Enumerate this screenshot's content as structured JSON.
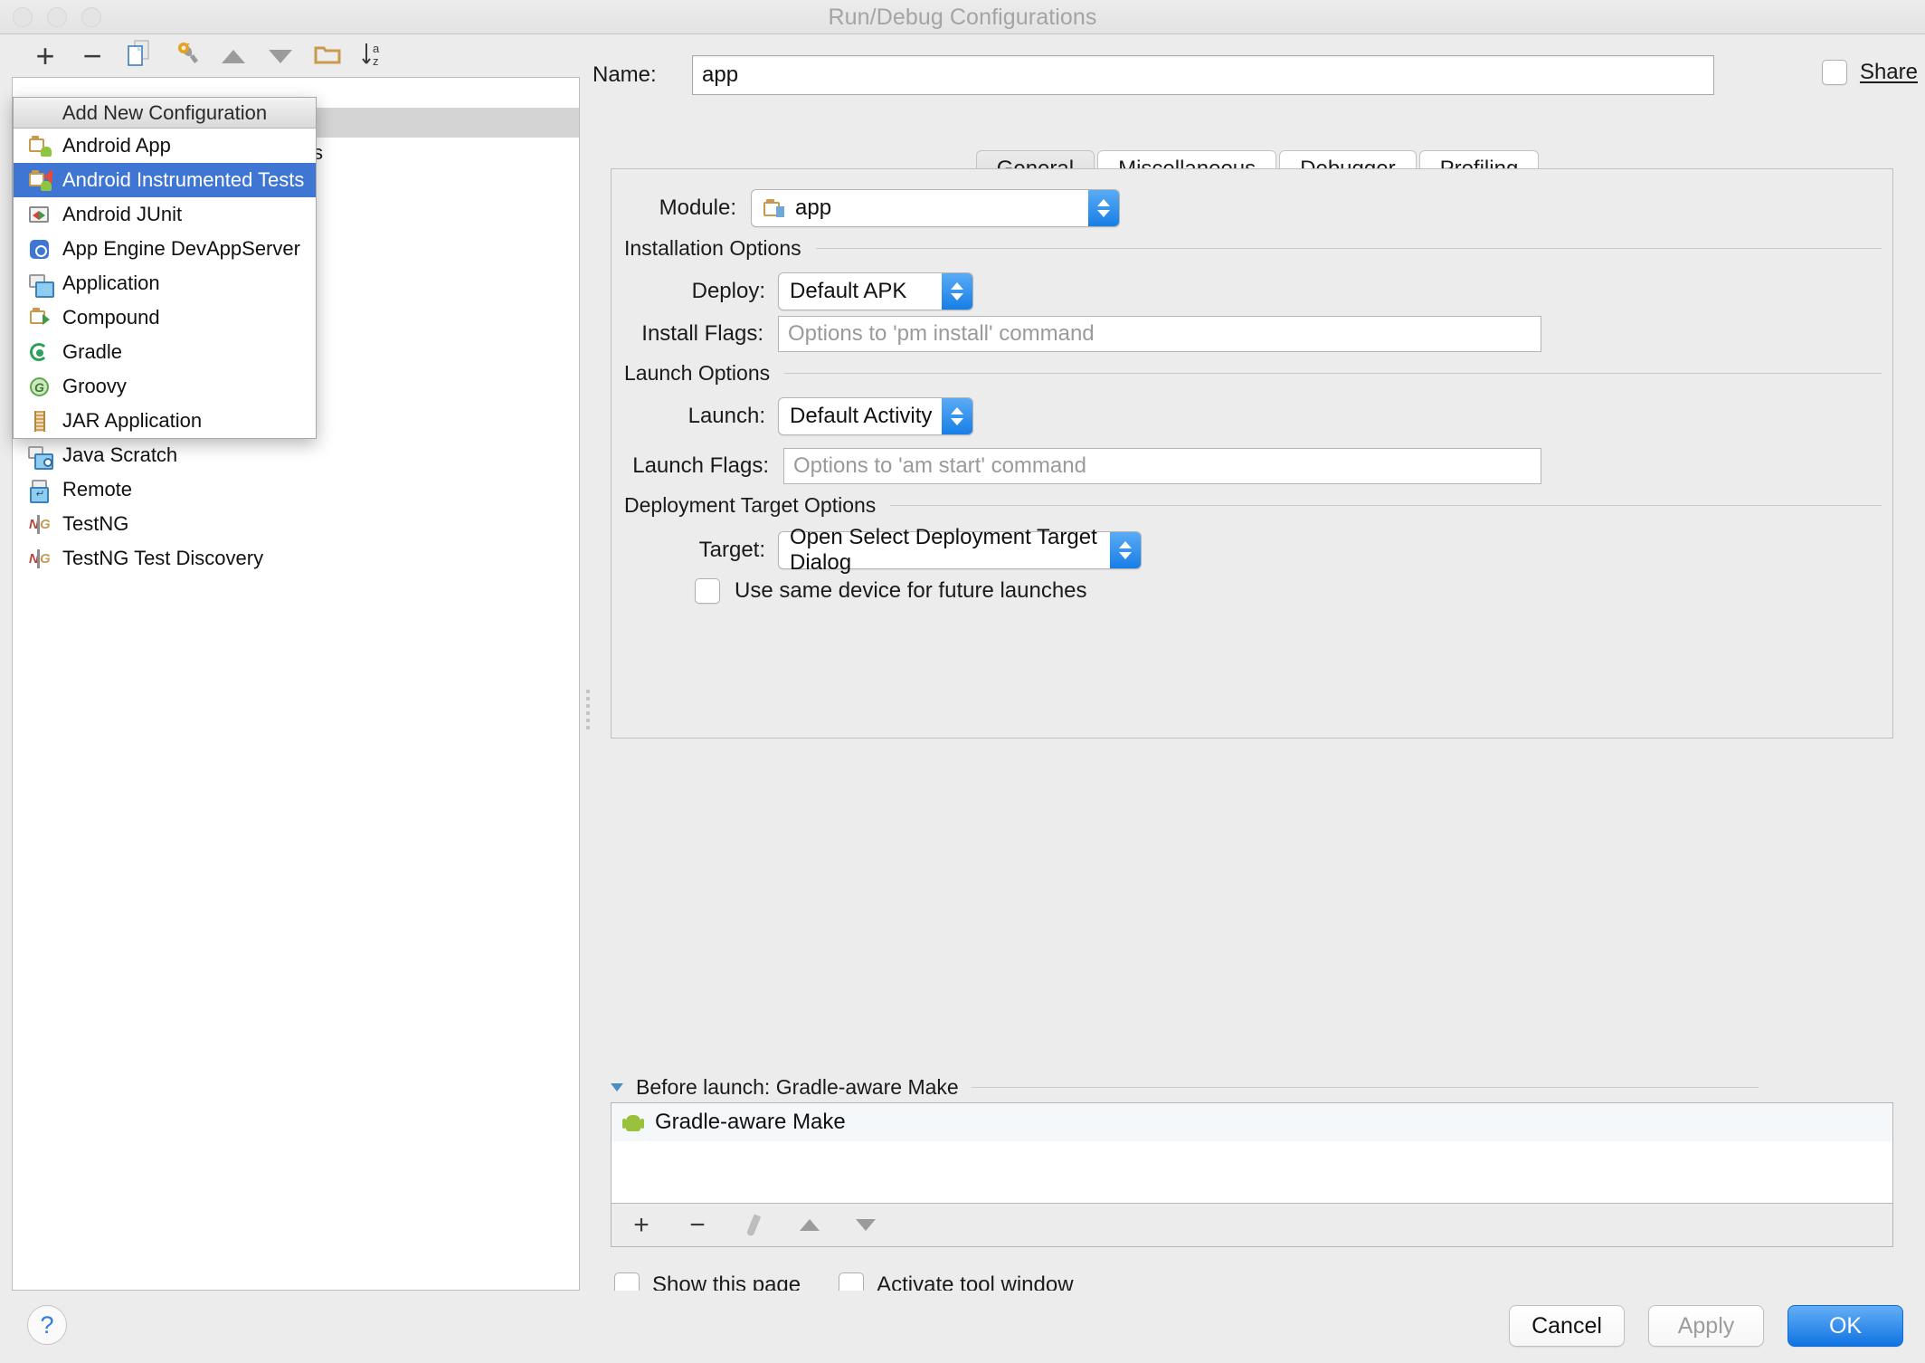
{
  "window": {
    "title": "Run/Debug Configurations"
  },
  "toolbar": {
    "add_label": "+",
    "remove_label": "−",
    "copy_icon": "copy-configuration-icon",
    "edit_defaults_icon": "edit-defaults-wrench-icon",
    "move_up_icon": "move-up-icon",
    "move_down_icon": "move-down-icon",
    "folder_icon": "new-folder-icon",
    "sort_icon": "sort-alphabetically-icon",
    "sort_label": "a\nz"
  },
  "tree": {
    "partial_item": "s"
  },
  "popup": {
    "title": "Add New Configuration",
    "items": [
      {
        "label": "Android App",
        "icon": "android-app-icon",
        "selected": false
      },
      {
        "label": "Android Instrumented Tests",
        "icon": "android-instrumented-tests-icon",
        "selected": true
      },
      {
        "label": "Android JUnit",
        "icon": "android-junit-icon",
        "selected": false
      },
      {
        "label": "App Engine DevAppServer",
        "icon": "app-engine-icon",
        "selected": false
      },
      {
        "label": "Application",
        "icon": "application-icon",
        "selected": false
      },
      {
        "label": "Compound",
        "icon": "compound-icon",
        "selected": false
      },
      {
        "label": "Gradle",
        "icon": "gradle-icon",
        "selected": false
      },
      {
        "label": "Groovy",
        "icon": "groovy-icon",
        "selected": false
      },
      {
        "label": "JAR Application",
        "icon": "jar-application-icon",
        "selected": false
      },
      {
        "label": "Java Scratch",
        "icon": "java-scratch-icon",
        "selected": false
      },
      {
        "label": "Remote",
        "icon": "remote-icon",
        "selected": false
      },
      {
        "label": "TestNG",
        "icon": "testng-icon",
        "selected": false
      },
      {
        "label": "TestNG Test Discovery",
        "icon": "testng-test-discovery-icon",
        "selected": false
      }
    ]
  },
  "name_field": {
    "label": "Name:",
    "value": "app",
    "placeholder": ""
  },
  "share": {
    "label": "Share",
    "checked": false
  },
  "tabs": [
    {
      "label": "General",
      "active": true
    },
    {
      "label": "Miscellaneous",
      "active": false
    },
    {
      "label": "Debugger",
      "active": false
    },
    {
      "label": "Profiling",
      "active": false
    }
  ],
  "general": {
    "module": {
      "label": "Module:",
      "value": "app"
    },
    "installation_options": {
      "title": "Installation Options",
      "deploy": {
        "label": "Deploy:",
        "value": "Default APK"
      },
      "install_flags": {
        "label": "Install Flags:",
        "value": "",
        "placeholder": "Options to 'pm install' command"
      }
    },
    "launch_options": {
      "title": "Launch Options",
      "launch": {
        "label": "Launch:",
        "value": "Default Activity"
      },
      "launch_flags": {
        "label": "Launch Flags:",
        "value": "",
        "placeholder": "Options to 'am start' command"
      }
    },
    "deployment_target_options": {
      "title": "Deployment Target Options",
      "target": {
        "label": "Target:",
        "value": "Open Select Deployment Target Dialog"
      },
      "use_same_device": {
        "label": "Use same device for future launches",
        "checked": false
      }
    }
  },
  "before_launch": {
    "header": "Before launch: Gradle-aware Make",
    "items": [
      {
        "label": "Gradle-aware Make",
        "icon": "android-robot-icon"
      }
    ],
    "toolbar": {
      "add": "+",
      "remove": "−",
      "edit_icon": "pencil-edit-icon",
      "up_icon": "move-up-icon",
      "down_icon": "move-down-icon"
    }
  },
  "bottom_checkboxes": [
    {
      "label": "Show this page",
      "checked": false
    },
    {
      "label": "Activate tool window",
      "checked": false
    }
  ],
  "footer": {
    "help_label": "?",
    "cancel_label": "Cancel",
    "apply_label": "Apply",
    "ok_label": "OK"
  },
  "colors": {
    "accent_blue": "#1074e2",
    "selection_blue": "#3f76d3",
    "window_bg": "#ececec",
    "android_green": "#9ac13c"
  }
}
